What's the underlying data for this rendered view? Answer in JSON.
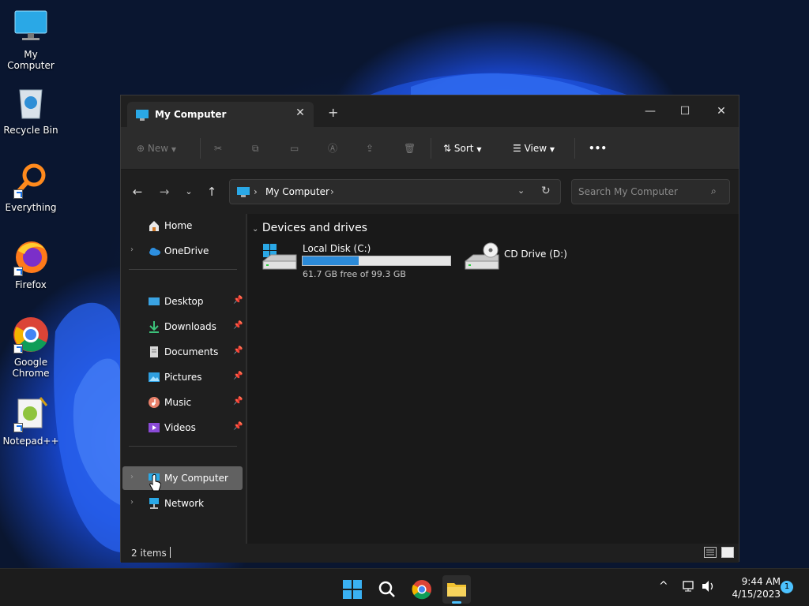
{
  "desktop": {
    "icons": [
      {
        "label": "My Computer"
      },
      {
        "label": "Recycle Bin"
      },
      {
        "label": "Everything"
      },
      {
        "label": "Firefox"
      },
      {
        "label": "Google Chrome"
      },
      {
        "label": "Notepad++"
      }
    ]
  },
  "window": {
    "tab_title": "My Computer",
    "tab_close": "✕",
    "new_tab": "+",
    "controls": {
      "minimize": "—",
      "maximize": "☐",
      "close": "✕"
    },
    "toolbar": {
      "new_label": "New",
      "sort_label": "Sort",
      "view_label": "View",
      "more_label": "•••"
    },
    "address": {
      "segment": "My Computer",
      "search_placeholder": "Search My Computer"
    },
    "sidebar": {
      "top": [
        {
          "label": "Home"
        },
        {
          "label": "OneDrive"
        }
      ],
      "pinned": [
        {
          "label": "Desktop"
        },
        {
          "label": "Downloads"
        },
        {
          "label": "Documents"
        },
        {
          "label": "Pictures"
        },
        {
          "label": "Music"
        },
        {
          "label": "Videos"
        }
      ],
      "bottom": [
        {
          "label": "My Computer"
        },
        {
          "label": "Network"
        }
      ]
    },
    "content": {
      "group_title": "Devices and drives",
      "drives": [
        {
          "name": "Local Disk (C:)",
          "free_text": "61.7 GB free of 99.3 GB",
          "used_fraction": 0.379
        },
        {
          "name": "CD Drive (D:)"
        }
      ]
    },
    "status": {
      "item_count": "2 items"
    }
  },
  "taskbar": {
    "time": "9:44 AM",
    "date": "4/15/2023",
    "notification_count": "1"
  },
  "colors": {
    "accent": "#2b8ad8",
    "selected": "#616161"
  }
}
